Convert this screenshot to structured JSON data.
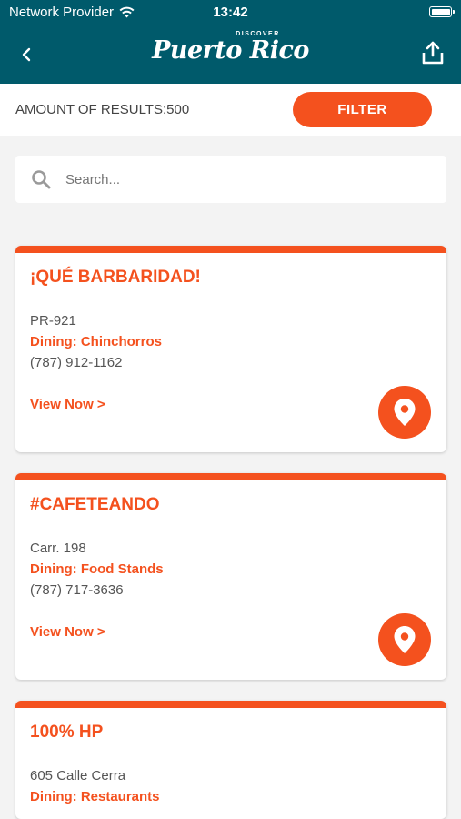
{
  "status": {
    "carrier": "Network Provider",
    "time": "13:42"
  },
  "header": {
    "logo_small": "DISCOVER",
    "logo_big": "Puerto Rico"
  },
  "results": {
    "label": "AMOUNT OF RESULTS:500",
    "filter_label": "FILTER"
  },
  "search": {
    "placeholder": "Search..."
  },
  "cards": [
    {
      "title": "¡QUÉ BARBARIDAD!",
      "address": "PR-921",
      "category": "Dining: Chinchorros",
      "phone": "(787) 912-1162",
      "link": "View Now >"
    },
    {
      "title": "#CAFETEANDO",
      "address": "Carr. 198",
      "category": "Dining: Food Stands",
      "phone": "(787) 717-3636",
      "link": "View Now >"
    },
    {
      "title": "100% HP",
      "address": "605 Calle Cerra",
      "category": "Dining: Restaurants"
    }
  ],
  "colors": {
    "header": "#005a6b",
    "accent": "#f4511e",
    "background": "#f3f3f3"
  },
  "icons": {
    "back": "chevron-left-icon",
    "share": "upload-share-icon",
    "search": "magnifier-icon",
    "map": "map-pin-icon"
  }
}
